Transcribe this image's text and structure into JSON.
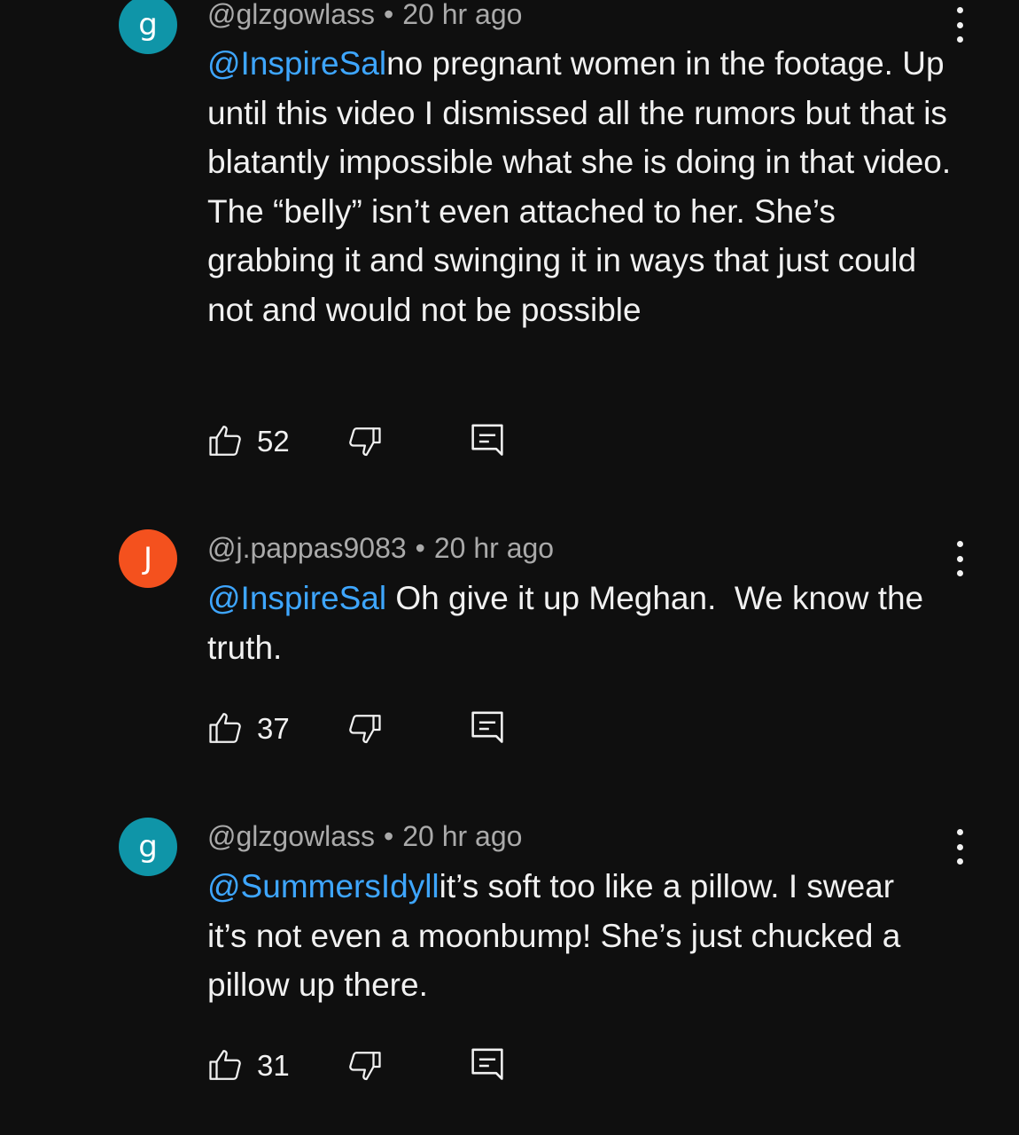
{
  "colors": {
    "background": "#0f0f0f",
    "mention": "#3ea6ff",
    "meta_text": "#aaaaaa",
    "avatar_teal": "#0f95a8",
    "avatar_orange": "#f4511e"
  },
  "comments": [
    {
      "avatar_letter": "g",
      "avatar_color": "#0f95a8",
      "handle": "@glzgowlass",
      "separator": "•",
      "time": "20 hr ago",
      "mention": "@InspireSal",
      "text": "no pregnant women in the footage. Up until this video I dismissed all the rumors but that is blatantly impossible what she is doing in that video. The “belly” isn’t even attached to her. She’s grabbing it and swinging it in ways that just could not and would not be possible",
      "likes": "52",
      "icons": {
        "more": "more-vert-icon",
        "like": "thumbs-up-icon",
        "dislike": "thumbs-down-icon",
        "reply": "reply-icon"
      }
    },
    {
      "avatar_letter": "J",
      "avatar_color": "#f4511e",
      "handle": "@j.pappas9083",
      "separator": "•",
      "time": "20 hr ago",
      "mention": "@InspireSal",
      "text": " Oh give it up Meghan.  We know the truth.",
      "likes": "37",
      "icons": {
        "more": "more-vert-icon",
        "like": "thumbs-up-icon",
        "dislike": "thumbs-down-icon",
        "reply": "reply-icon"
      }
    },
    {
      "avatar_letter": "g",
      "avatar_color": "#0f95a8",
      "handle": "@glzgowlass",
      "separator": "•",
      "time": "20 hr ago",
      "mention": "@SummersIdyll",
      "text": "it’s soft too like a pillow. I swear it’s not even a moonbump! She’s just chucked a pillow up there.",
      "likes": "31",
      "icons": {
        "more": "more-vert-icon",
        "like": "thumbs-up-icon",
        "dislike": "thumbs-down-icon",
        "reply": "reply-icon"
      }
    }
  ]
}
